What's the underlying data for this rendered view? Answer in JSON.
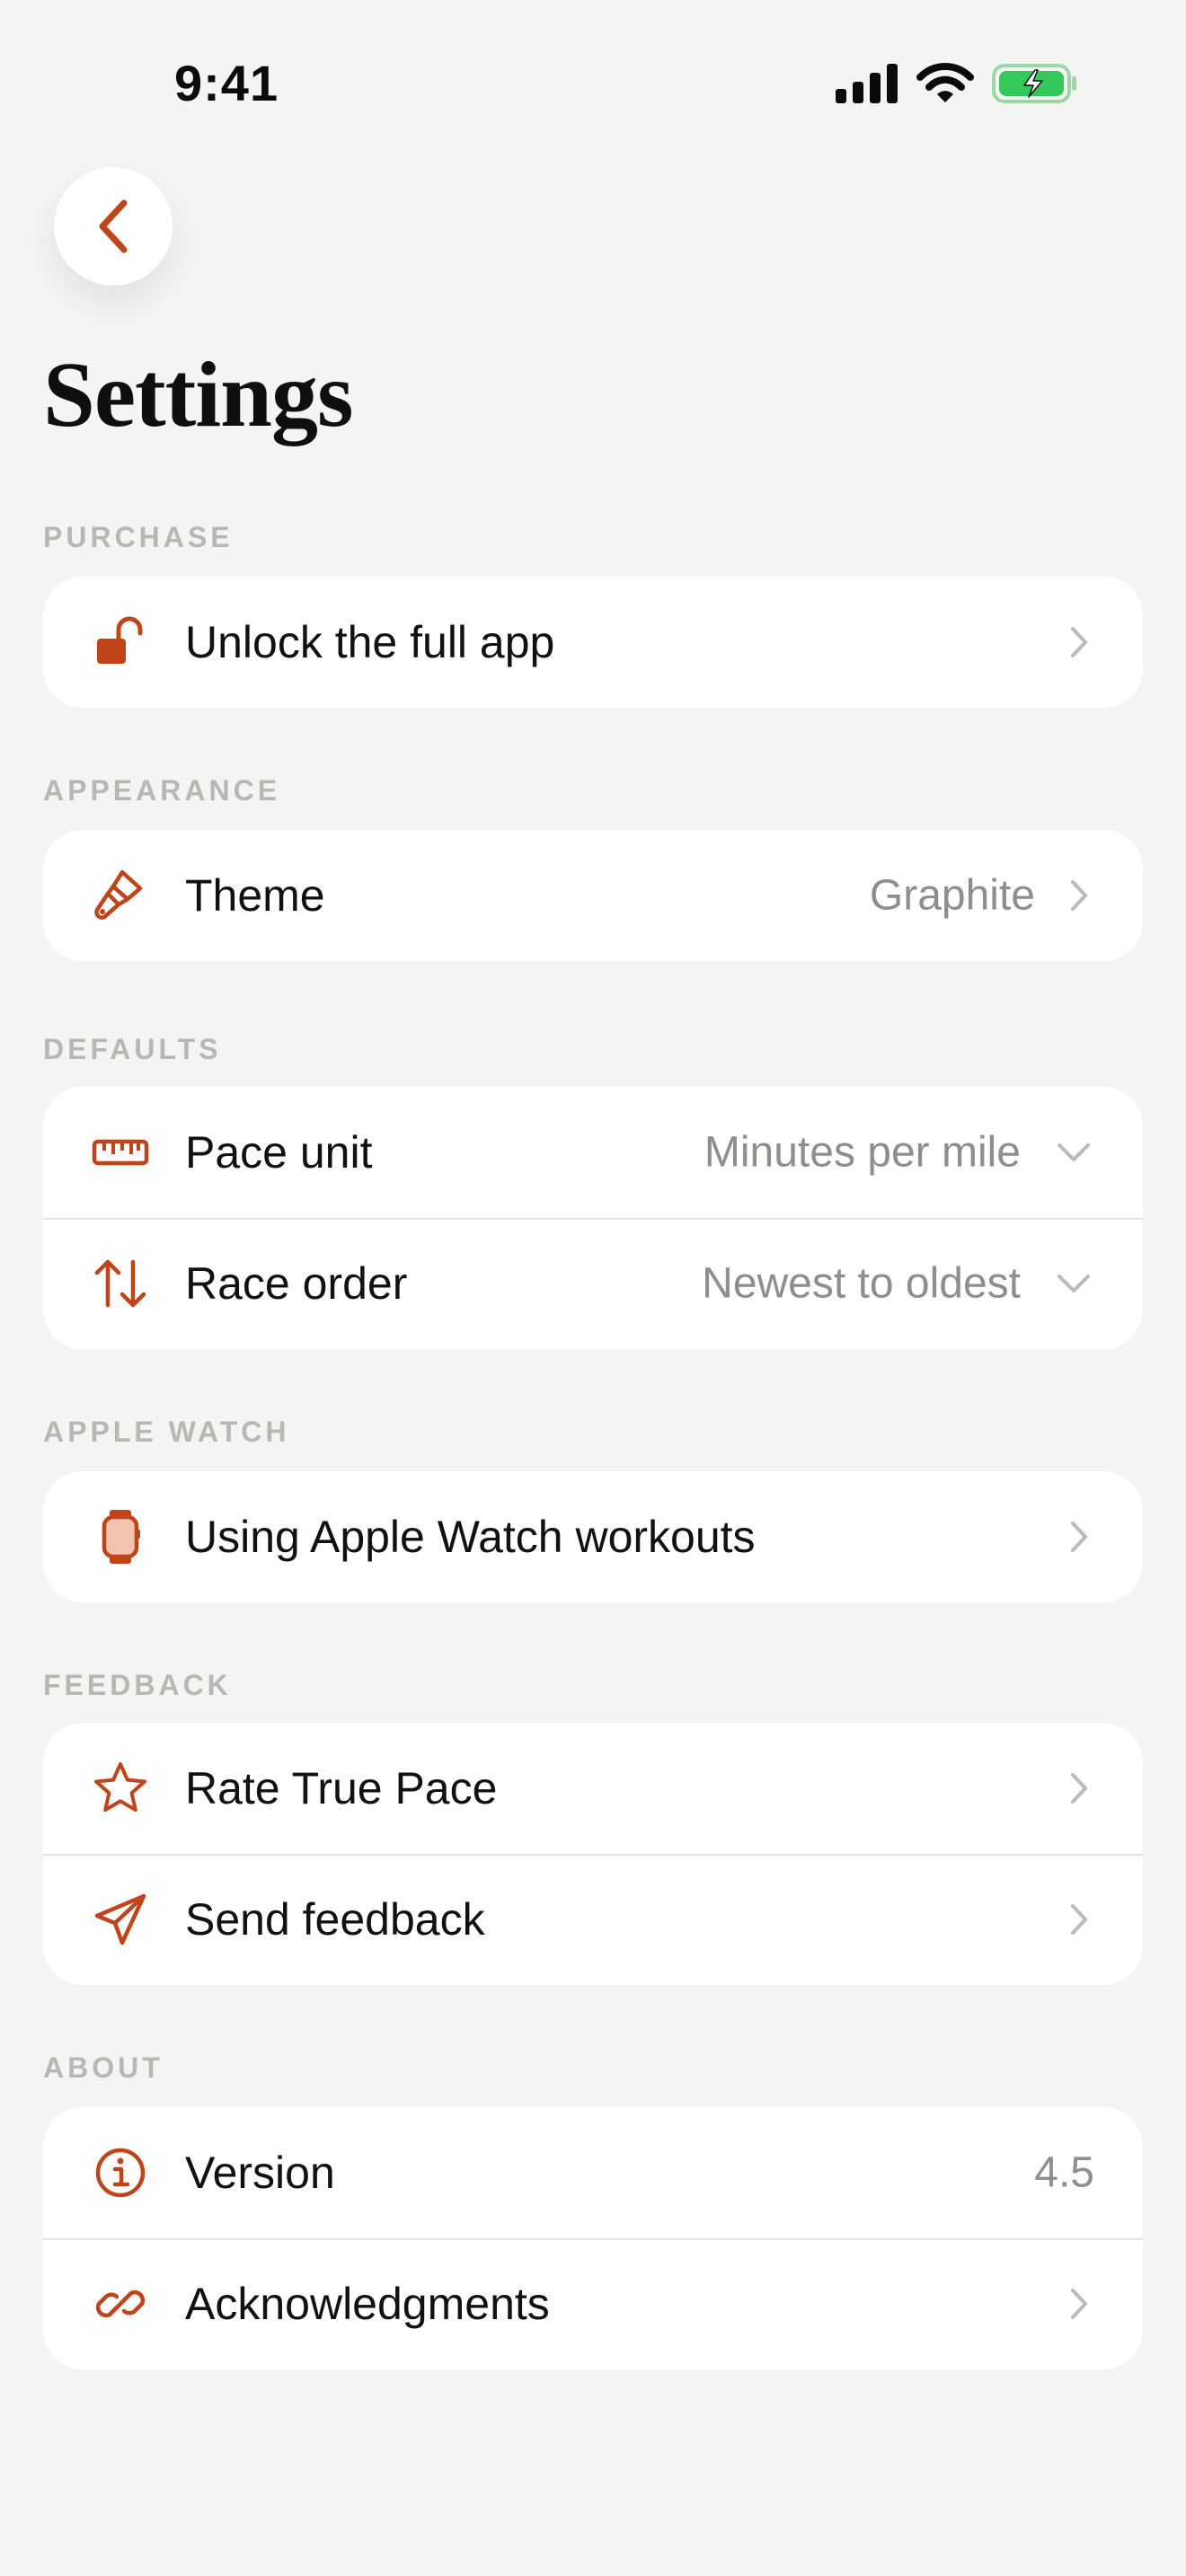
{
  "status_bar": {
    "time": "9:41",
    "icons": [
      "signal-icon",
      "wifi-icon",
      "battery-charging-icon"
    ]
  },
  "header": {
    "title": "Settings",
    "back_icon": "chevron-left-icon"
  },
  "sections": {
    "purchase": {
      "title": "PURCHASE",
      "items": [
        {
          "label": "Unlock the full app",
          "icon": "unlock-icon"
        }
      ]
    },
    "appearance": {
      "title": "APPEARANCE",
      "items": [
        {
          "label": "Theme",
          "value": "Graphite",
          "icon": "paintbrush-icon"
        }
      ]
    },
    "defaults": {
      "title": "DEFAULTS",
      "items": [
        {
          "label": "Pace unit",
          "value": "Minutes per mile",
          "icon": "ruler-icon"
        },
        {
          "label": "Race order",
          "value": "Newest to oldest",
          "icon": "sort-arrows-icon"
        }
      ]
    },
    "apple_watch": {
      "title": "APPLE WATCH",
      "items": [
        {
          "label": "Using Apple Watch workouts",
          "icon": "watch-icon"
        }
      ]
    },
    "feedback": {
      "title": "FEEDBACK",
      "items": [
        {
          "label": "Rate True Pace",
          "icon": "star-icon"
        },
        {
          "label": "Send feedback",
          "icon": "paper-plane-icon"
        }
      ]
    },
    "about": {
      "title": "ABOUT",
      "items": [
        {
          "label": "Version",
          "value": "4.5",
          "icon": "info-icon"
        },
        {
          "label": "Acknowledgments",
          "icon": "link-icon"
        }
      ]
    }
  },
  "colors": {
    "accent": "#C0441A",
    "background": "#F4F4F2",
    "card": "#FFFFFF",
    "secondary_text": "#8E8E8B",
    "section_header": "#B7B7B4",
    "chevron": "#BBBBB8",
    "battery_green": "#34C759"
  }
}
